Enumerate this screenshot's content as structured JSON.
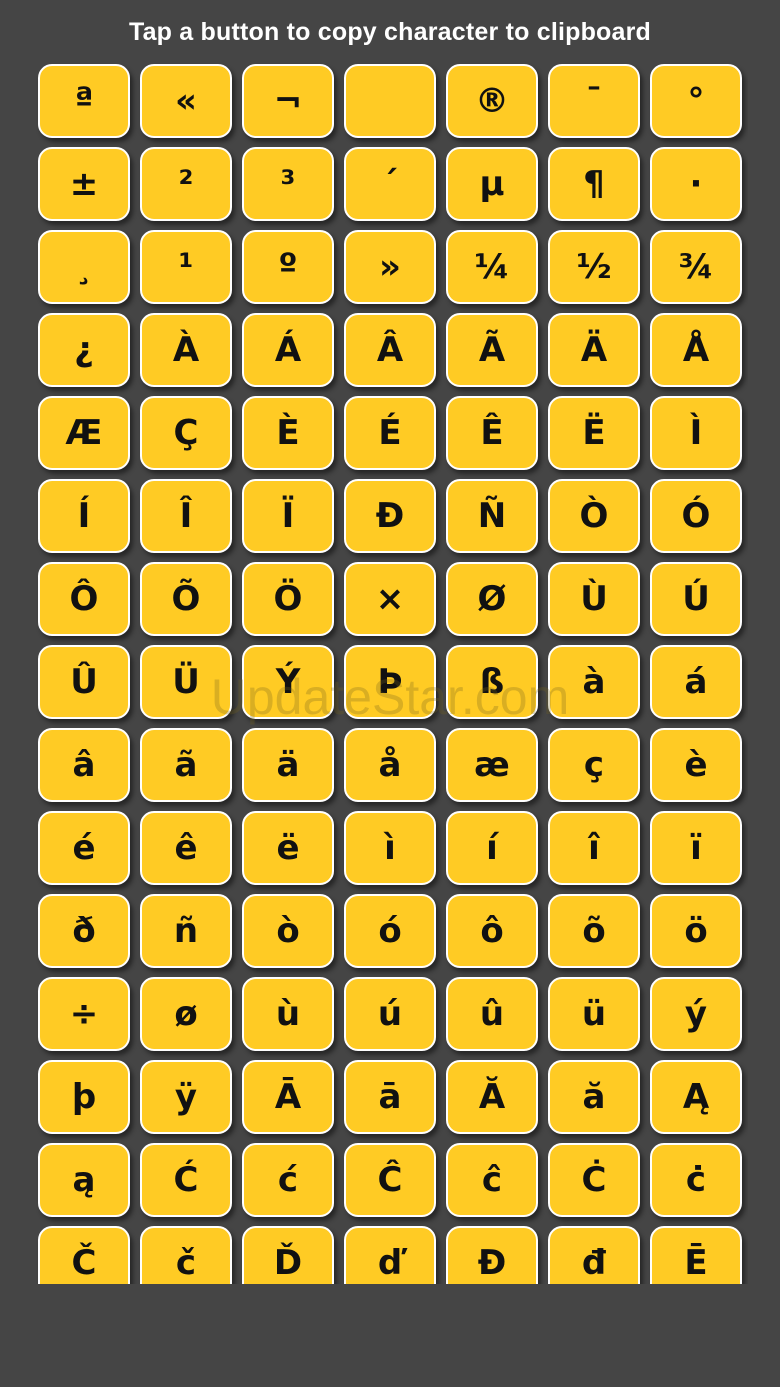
{
  "header": {
    "title": "Tap a button to copy character to clipboard"
  },
  "watermark": "UpdateStar.com",
  "colors": {
    "background": "#454545",
    "key_fill": "#ffcb24",
    "key_border": "#ffffff",
    "key_text": "#111111"
  },
  "keys": [
    "ª",
    "«",
    "¬",
    "­",
    "®",
    "¯",
    "°",
    "±",
    "²",
    "³",
    "´",
    "µ",
    "¶",
    "·",
    "¸",
    "¹",
    "º",
    "»",
    "¼",
    "½",
    "¾",
    "¿",
    "À",
    "Á",
    "Â",
    "Ã",
    "Ä",
    "Å",
    "Æ",
    "Ç",
    "È",
    "É",
    "Ê",
    "Ë",
    "Ì",
    "Í",
    "Î",
    "Ï",
    "Ð",
    "Ñ",
    "Ò",
    "Ó",
    "Ô",
    "Õ",
    "Ö",
    "×",
    "Ø",
    "Ù",
    "Ú",
    "Û",
    "Ü",
    "Ý",
    "Þ",
    "ß",
    "à",
    "á",
    "â",
    "ã",
    "ä",
    "å",
    "æ",
    "ç",
    "è",
    "é",
    "ê",
    "ë",
    "ì",
    "í",
    "î",
    "ï",
    "ð",
    "ñ",
    "ò",
    "ó",
    "ô",
    "õ",
    "ö",
    "÷",
    "ø",
    "ù",
    "ú",
    "û",
    "ü",
    "ý",
    "þ",
    "ÿ",
    "Ā",
    "ā",
    "Ă",
    "ă",
    "Ą",
    "ą",
    "Ć",
    "ć",
    "Ĉ",
    "ĉ",
    "Ċ",
    "ċ",
    "Č",
    "č",
    "Ď",
    "ď",
    "Đ",
    "đ",
    "Ē"
  ]
}
